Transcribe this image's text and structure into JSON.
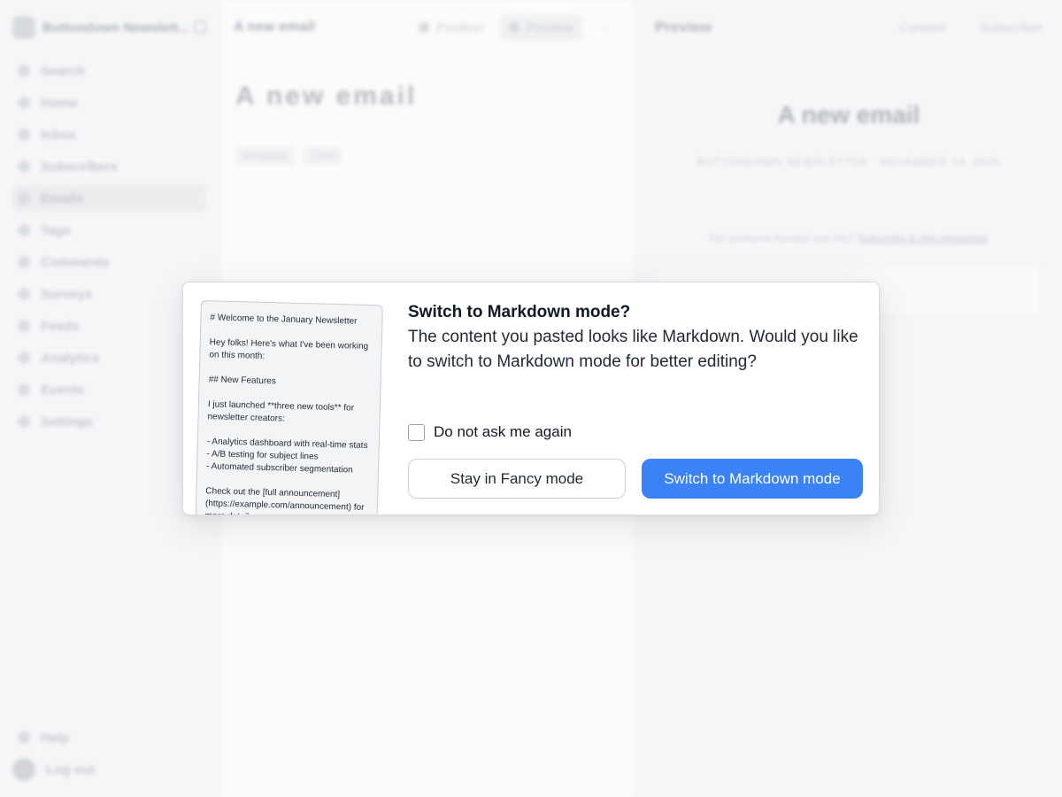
{
  "sidebar": {
    "workspace_name": "Buttondown Newslett...",
    "items": [
      {
        "label": "Search",
        "icon": "search-icon"
      },
      {
        "label": "Home",
        "icon": "home-icon"
      },
      {
        "label": "Inbox",
        "icon": "inbox-icon"
      },
      {
        "label": "Subscribers",
        "icon": "users-icon"
      },
      {
        "label": "Emails",
        "icon": "mail-icon",
        "active": true
      },
      {
        "label": "Tags",
        "icon": "tag-icon"
      },
      {
        "label": "Comments",
        "icon": "comment-icon"
      },
      {
        "label": "Surveys",
        "icon": "survey-icon"
      },
      {
        "label": "Feeds",
        "icon": "rss-icon"
      },
      {
        "label": "Analytics",
        "icon": "chart-icon"
      },
      {
        "label": "Events",
        "icon": "events-icon"
      },
      {
        "label": "Settings",
        "icon": "gear-icon"
      }
    ],
    "bottom_items": [
      {
        "label": "Help",
        "icon": "help-icon"
      },
      {
        "label": "Log out",
        "icon": "avatar"
      }
    ]
  },
  "editor": {
    "title_small": "A new email",
    "position_label": "Position",
    "preview_label": "Preview",
    "big_title": "A new email",
    "meta": [
      "Metadata",
      "Draft"
    ]
  },
  "preview": {
    "title": "Preview",
    "content_select": "Content",
    "subscriber_select": "Subscriber",
    "heading": "A new email",
    "subline": "BUTTONDOWN NEWSLETTER · NOVEMBER 14, 2025",
    "forward_text": "Did someone forward you this?",
    "forward_link": "Subscribe to this newsletter"
  },
  "dialog": {
    "markdown_preview": [
      "# Welcome to the January Newsletter",
      "",
      "Hey folks! Here's what I've been working",
      "on this month:",
      "",
      "## New Features",
      "",
      "I just launched **three new tools** for",
      "newsletter creators:",
      "",
      "- Analytics dashboard with real-time stats",
      "- A/B testing for subject lines",
      "- Automated subscriber segmentation",
      "",
      "Check out the [full announcement]",
      "(https://example.com/announcement) for",
      "more details."
    ],
    "title": "Switch to Markdown mode?",
    "message": "The content you pasted looks like Markdown. Would you like to switch to Markdown mode for better editing?",
    "checkbox_label": "Do not ask me again",
    "checkbox_checked": false,
    "secondary_button": "Stay in Fancy mode",
    "primary_button": "Switch to Markdown mode",
    "primary_color": "#3b82f6"
  }
}
